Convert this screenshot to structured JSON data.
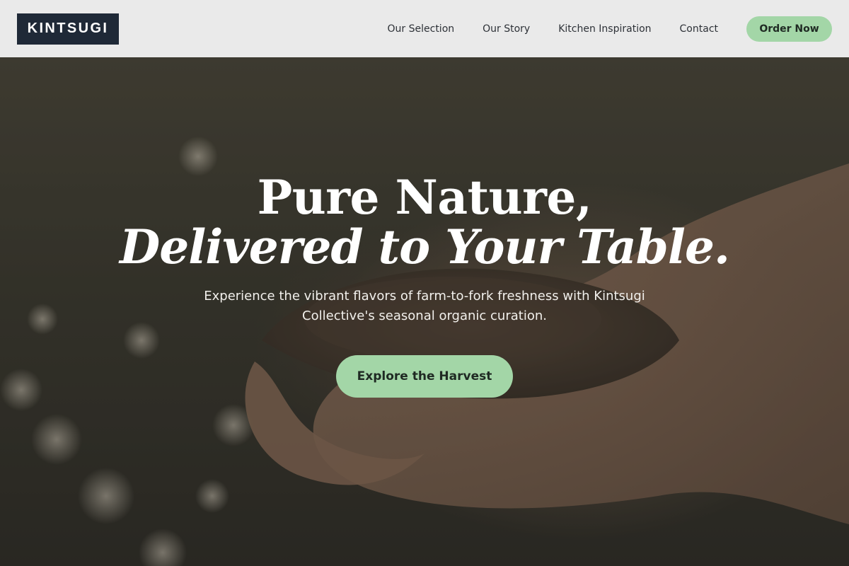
{
  "header": {
    "logo_text": "KINTSUGI",
    "nav": [
      {
        "label": "Our Selection"
      },
      {
        "label": "Our Story"
      },
      {
        "label": "Kitchen Inspiration"
      },
      {
        "label": "Contact"
      }
    ],
    "order_button": "Order Now"
  },
  "hero": {
    "title_line1": "Pure Nature,",
    "title_line2": "Delivered to Your Table.",
    "subtitle": "Experience the vibrant flavors of farm-to-fork freshness with Kintsugi Collective's seasonal organic curation.",
    "cta_button": "Explore the Harvest",
    "background_image": "hands-holding-soil-photo"
  },
  "colors": {
    "header_bg": "#eaeaea",
    "logo_bg": "#1f2937",
    "accent_green": "#a3d6a7",
    "hero_text": "#ffffff"
  }
}
